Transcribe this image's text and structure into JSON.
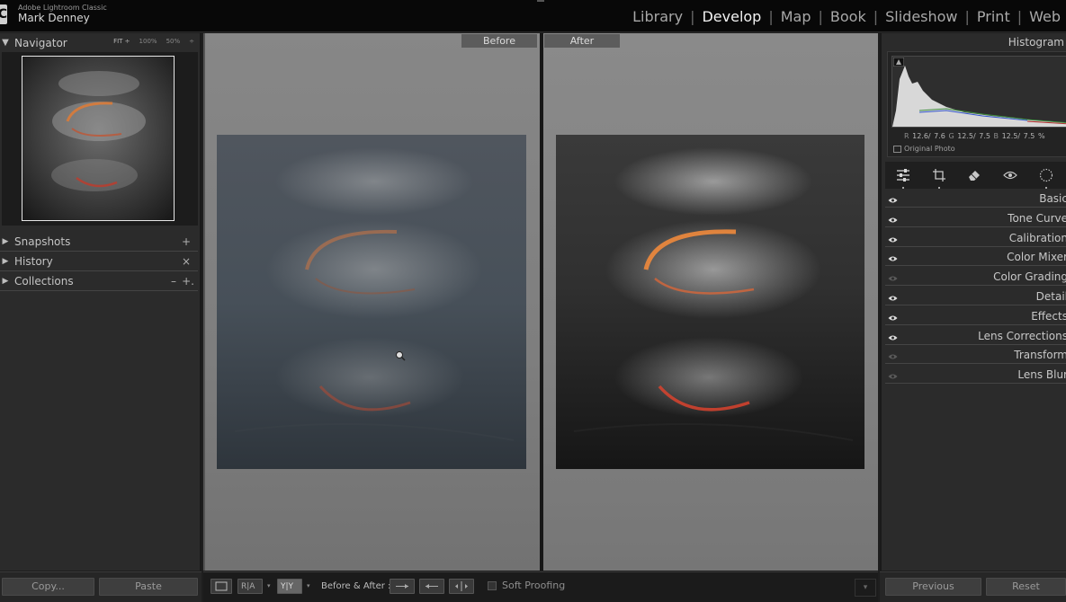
{
  "app": {
    "logo_letter": "C",
    "name": "Adobe Lightroom Classic",
    "user": "Mark Denney"
  },
  "modules": {
    "items": [
      "Library",
      "Develop",
      "Map",
      "Book",
      "Slideshow",
      "Print",
      "Web"
    ],
    "active": "Develop"
  },
  "left_panel": {
    "navigator": {
      "title": "Navigator",
      "zoom_fit": "FIT ÷",
      "zoom_100": "100%",
      "zoom_50": "50%",
      "zoom_menu": "÷"
    },
    "snapshots": {
      "title": "Snapshots",
      "action": "+"
    },
    "history": {
      "title": "History",
      "action": "×"
    },
    "collections": {
      "title": "Collections",
      "action_minus": "–",
      "action_plus": "+."
    }
  },
  "center": {
    "before_label": "Before",
    "after_label": "After"
  },
  "right_panel": {
    "histogram": {
      "title": "Histogram",
      "r_label": "R",
      "r_value": "12.6/",
      "v1": "7.6",
      "g_label": "G",
      "g_value": "12.5/",
      "v2": "7.5",
      "b_label": "B",
      "b_value": "12.5/",
      "v3": "7.5",
      "unit": "%",
      "original_photo": "Original Photo"
    },
    "sections": [
      {
        "label": "Basic",
        "eye_on": true
      },
      {
        "label": "Tone Curve",
        "eye_on": true
      },
      {
        "label": "Calibration",
        "eye_on": true
      },
      {
        "label": "Color Mixer",
        "eye_on": true
      },
      {
        "label": "Color Grading",
        "eye_on": false
      },
      {
        "label": "Detail",
        "eye_on": true
      },
      {
        "label": "Effects",
        "eye_on": true
      },
      {
        "label": "Lens Corrections",
        "eye_on": true
      },
      {
        "label": "Transform",
        "eye_on": false
      },
      {
        "label": "Lens Blur",
        "eye_on": false
      }
    ]
  },
  "toolbar": {
    "before_after_label": "Before & After :",
    "soft_proofing": "Soft Proofing",
    "ra_glyph": "R|A",
    "yy_glyph": "Y|Y"
  },
  "buttons": {
    "copy": "Copy...",
    "paste": "Paste",
    "previous": "Previous",
    "reset": "Reset"
  }
}
